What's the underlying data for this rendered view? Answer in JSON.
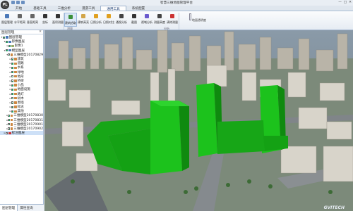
{
  "window": {
    "title": "智慧三维地图管理平台",
    "logo": "PL",
    "controls": [
      "—",
      "□",
      "✕"
    ]
  },
  "tabs": [
    "开始",
    "基础工具",
    "三维分析",
    "漫游工具",
    "通用工具",
    "系统配置"
  ],
  "active_tab": 4,
  "ribbon": {
    "buttons": [
      {
        "label": "图层管理",
        "icon": "layers-icon"
      },
      {
        "label": "水平距离",
        "icon": "ruler-horizontal-icon"
      },
      {
        "label": "垂直距离",
        "icon": "ruler-vertical-icon"
      },
      {
        "label": "坐标",
        "icon": "crosshair-icon"
      },
      {
        "label": "面积测量",
        "icon": "area-icon"
      },
      {
        "label": "建筑拾取",
        "icon": "building-pick-icon"
      },
      {
        "label": "建筑高亮",
        "icon": "building-highlight-icon"
      },
      {
        "label": "日照分析",
        "icon": "sun-icon"
      },
      {
        "label": "日照对比",
        "icon": "sun-compare-icon"
      },
      {
        "label": "通视分析",
        "icon": "eye-icon"
      },
      {
        "label": "截图",
        "icon": "camera-icon"
      },
      {
        "label": "视域分析",
        "icon": "viewshed-icon"
      },
      {
        "label": "测量高度",
        "icon": "height-icon"
      },
      {
        "label": "清除测量",
        "icon": "clear-icon"
      }
    ],
    "selected_button": 5,
    "groups": [
      "测量",
      "分析"
    ],
    "slider_label": "地面透明度"
  },
  "panel": {
    "title": "图层管理",
    "close": "✕",
    "tree": [
      {
        "label": "图层管理",
        "depth": 0,
        "expanded": true,
        "checked": true,
        "color": "#4a78b8"
      },
      {
        "label": "影像图层",
        "depth": 1,
        "expanded": true,
        "checked": true,
        "color": "#4a78b8"
      },
      {
        "label": "影像1",
        "depth": 2,
        "expanded": false,
        "checked": true,
        "color": "#9a6"
      },
      {
        "label": "模型图层",
        "depth": 1,
        "expanded": true,
        "checked": true,
        "color": "#4a78b8"
      },
      {
        "label": "三维模型20170829",
        "depth": 2,
        "expanded": true,
        "checked": true,
        "color": "#c84"
      },
      {
        "label": "建筑",
        "depth": 3,
        "expanded": false,
        "checked": true,
        "color": "#c84"
      },
      {
        "label": "道路",
        "depth": 3,
        "expanded": false,
        "checked": true,
        "color": "#c84"
      },
      {
        "label": "水系",
        "depth": 3,
        "expanded": false,
        "checked": true,
        "color": "#c84"
      },
      {
        "label": "绿地",
        "depth": 3,
        "expanded": false,
        "checked": true,
        "color": "#c84"
      },
      {
        "label": "地形",
        "depth": 3,
        "expanded": false,
        "checked": true,
        "color": "#c84"
      },
      {
        "label": "桥梁",
        "depth": 3,
        "expanded": false,
        "checked": true,
        "color": "#c84"
      },
      {
        "label": "小品",
        "depth": 3,
        "expanded": false,
        "checked": true,
        "color": "#c84"
      },
      {
        "label": "地面设施",
        "depth": 3,
        "expanded": false,
        "checked": true,
        "color": "#c84"
      },
      {
        "label": "路灯",
        "depth": 3,
        "expanded": false,
        "checked": true,
        "color": "#c84"
      },
      {
        "label": "树木",
        "depth": 3,
        "expanded": false,
        "checked": true,
        "color": "#c84"
      },
      {
        "label": "围墙",
        "depth": 3,
        "expanded": false,
        "checked": true,
        "color": "#c84"
      },
      {
        "label": "标志",
        "depth": 3,
        "expanded": false,
        "checked": true,
        "color": "#c84"
      },
      {
        "label": "其他",
        "depth": 3,
        "expanded": false,
        "checked": true,
        "color": "#c84"
      },
      {
        "label": "三维模型20170830",
        "depth": 2,
        "expanded": false,
        "checked": true,
        "color": "#c84"
      },
      {
        "label": "三维模型20170831",
        "depth": 2,
        "expanded": false,
        "checked": true,
        "color": "#c84"
      },
      {
        "label": "三维模型20170901",
        "depth": 2,
        "expanded": false,
        "checked": true,
        "color": "#c84"
      },
      {
        "label": "三维模型20170902",
        "depth": 2,
        "expanded": false,
        "checked": true,
        "color": "#c84"
      },
      {
        "label": "标注图层",
        "depth": 1,
        "expanded": false,
        "checked": false,
        "color": "#c33",
        "selected": true
      }
    ],
    "tabs": [
      "图层管理",
      "属性查询"
    ],
    "active_tab": 0
  },
  "scene": {
    "brand": "GVITECH",
    "highlight_color": "#19b319"
  }
}
